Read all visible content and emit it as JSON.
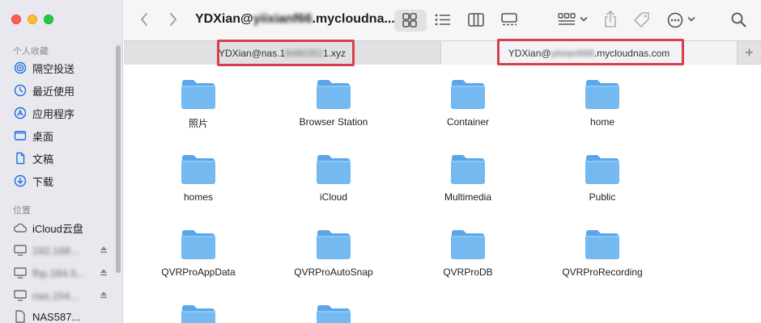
{
  "window": {
    "title_prefix": "YDXian@",
    "title_blurred": "yiixianf66",
    "title_suffix": ".mycloudna..."
  },
  "sidebar": {
    "favorites_header": "个人收藏",
    "favorites": [
      {
        "label": "隔空投送",
        "icon": "airdrop-icon"
      },
      {
        "label": "最近使用",
        "icon": "clock-icon"
      },
      {
        "label": "应用程序",
        "icon": "apps-icon"
      },
      {
        "label": "桌面",
        "icon": "desktop-icon"
      },
      {
        "label": "文稿",
        "icon": "document-icon"
      },
      {
        "label": "下载",
        "icon": "download-icon"
      }
    ],
    "locations_header": "位置",
    "icloud_label": "iCloud云盘",
    "locations": [
      {
        "label": "192.168...",
        "blurred": true
      },
      {
        "label": "fhp.184.5...",
        "blurred": true
      },
      {
        "label": "nas.154...",
        "blurred": true
      }
    ],
    "nas_label": "NAS587..."
  },
  "tabs": {
    "left_prefix": "YDXian@nas.1",
    "left_blurred": "9480351",
    "left_suffix": "1.xyz",
    "right_prefix": "YDXian@",
    "right_blurred": "yiixian666",
    "right_suffix": ".mycloudnas.com",
    "new_tab": "+"
  },
  "folders": [
    "照片",
    "Browser Station",
    "Container",
    "home",
    "homes",
    "iCloud",
    "Multimedia",
    "Public",
    "QVRProAppData",
    "QVRProAutoSnap",
    "QVRProDB",
    "QVRProRecording"
  ],
  "colors": {
    "highlight": "#d63f4c",
    "folder": "#74b9f0",
    "accent": "#1d6fe0"
  }
}
